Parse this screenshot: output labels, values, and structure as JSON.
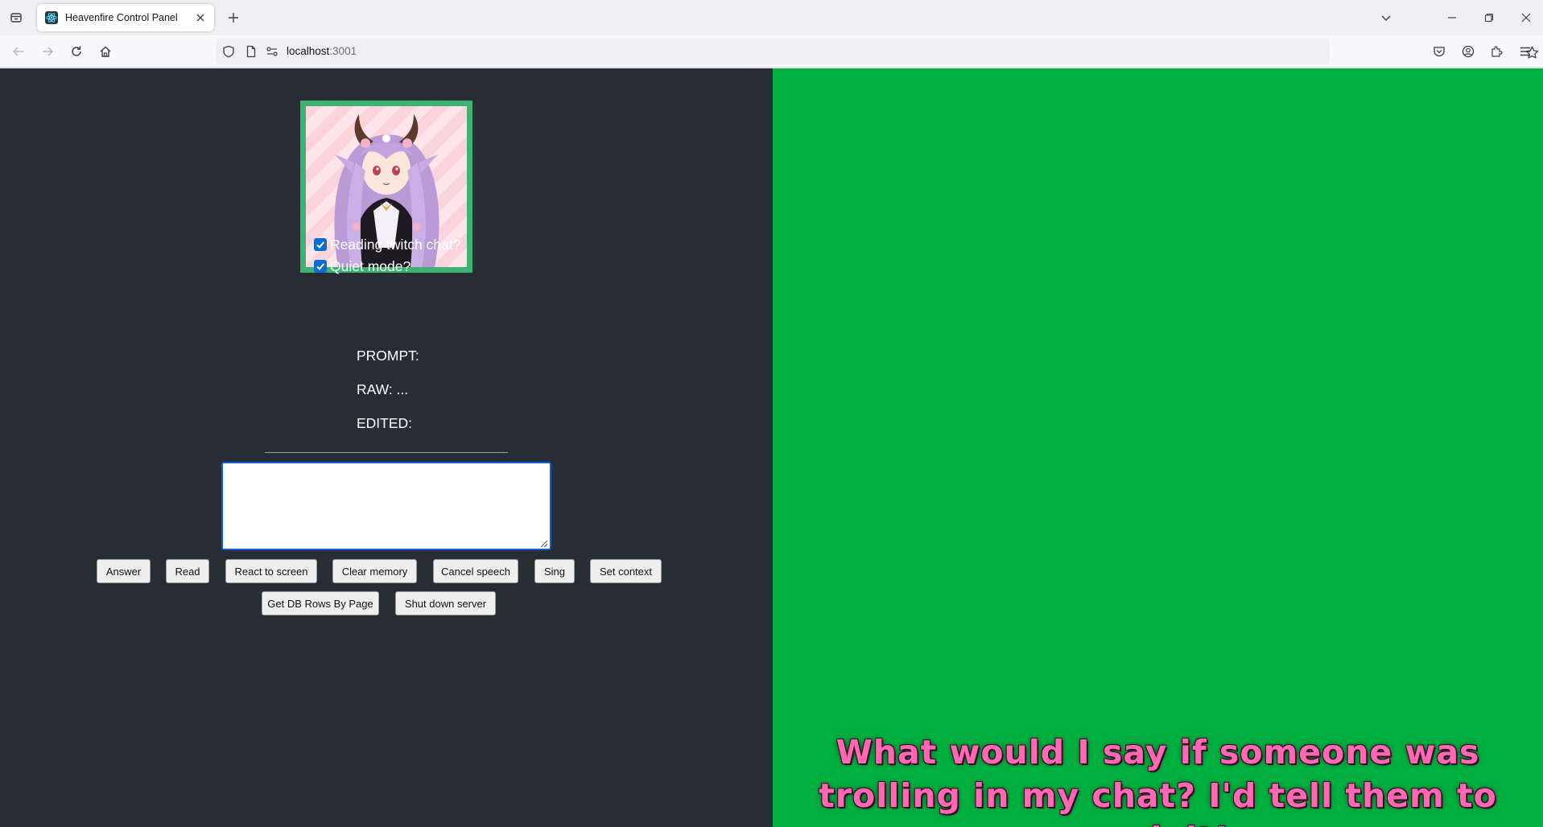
{
  "browser": {
    "tab_title": "Heavenfire Control Panel",
    "url_host": "localhost",
    "url_port": ":3001"
  },
  "controls": {
    "reading_chat_label": "Reading twitch chat?",
    "reading_chat_checked": true,
    "quiet_mode_label": "Quiet mode?",
    "quiet_mode_checked": true,
    "prompt_label": "PROMPT:",
    "raw_label": "RAW: ...",
    "edited_label": "EDITED:",
    "textarea_value": ""
  },
  "buttons": {
    "answer": "Answer",
    "read": "Read",
    "react": "React to screen",
    "clear_memory": "Clear memory",
    "cancel_speech": "Cancel speech",
    "sing": "Sing",
    "set_context": "Set context",
    "get_db_rows": "Get DB Rows By Page",
    "shut_down": "Shut down server"
  },
  "overlay": {
    "caption": "What would I say if someone was trolling in my chat? I'd tell them to suck it!",
    "background_color": "#00b140",
    "caption_color": "#ff69b4"
  },
  "icons": {
    "tab_list": "tab-list-icon",
    "favicon": "react-logo-icon",
    "close": "close-icon",
    "new_tab": "plus-icon",
    "back": "back-arrow-icon",
    "forward": "forward-arrow-icon",
    "reload": "reload-icon",
    "home": "home-icon",
    "shield": "shield-icon",
    "page": "page-icon",
    "permissions": "permissions-icon",
    "bookmark": "star-icon",
    "pocket": "pocket-icon",
    "account": "account-icon",
    "extensions": "puzzle-icon",
    "menu": "hamburger-menu-icon"
  }
}
